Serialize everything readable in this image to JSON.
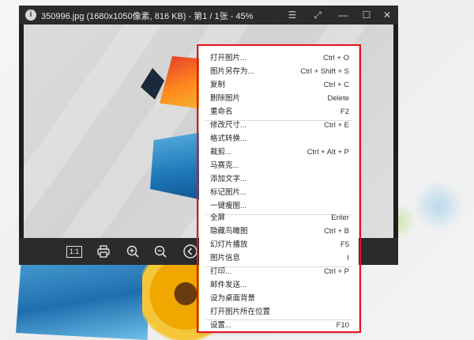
{
  "window": {
    "title": "350996.jpg (1680x1050像素, 816 KB) - 第1 / 1张 - 45%",
    "info_glyph": "i",
    "controls": {
      "menu": "☰",
      "restore": "⤢",
      "minimize": "—",
      "maximize": "☐",
      "close": "✕"
    }
  },
  "toolbar": {
    "actual_size_label": "1:1",
    "icons": [
      "print-icon",
      "zoom-in-icon",
      "zoom-out-icon",
      "previous-icon"
    ]
  },
  "context_menu": {
    "items": [
      {
        "label": "打开图片...",
        "shortcut": "Ctrl + O"
      },
      {
        "label": "图片另存为...",
        "shortcut": "Ctrl + Shift + S"
      },
      {
        "label": "复制",
        "shortcut": "Ctrl + C"
      },
      {
        "label": "删除图片",
        "shortcut": "Delete"
      },
      {
        "label": "重命名",
        "shortcut": "F2"
      },
      {
        "label": "修改尺寸...",
        "shortcut": "Ctrl + E"
      },
      {
        "label": "格式转换...",
        "shortcut": ""
      },
      {
        "label": "裁剪...",
        "shortcut": "Ctrl + Alt + P"
      },
      {
        "label": "马赛克...",
        "shortcut": ""
      },
      {
        "label": "添加文字...",
        "shortcut": ""
      },
      {
        "label": "标记图片...",
        "shortcut": ""
      },
      {
        "label": "一键瘦图...",
        "shortcut": ""
      },
      {
        "label": "全屏",
        "shortcut": "Enter"
      },
      {
        "label": "隐藏鸟瞰图",
        "shortcut": "Ctrl + B"
      },
      {
        "label": "幻灯片播放",
        "shortcut": "F5"
      },
      {
        "label": "图片信息",
        "shortcut": "I"
      },
      {
        "label": "打印...",
        "shortcut": "Ctrl + P"
      },
      {
        "label": "邮件发送...",
        "shortcut": ""
      },
      {
        "label": "设为桌面背景",
        "shortcut": ""
      },
      {
        "label": "打开图片所在位置",
        "shortcut": ""
      },
      {
        "label": "设置...",
        "shortcut": "F10"
      }
    ],
    "highlight_color": "#e8121b"
  }
}
